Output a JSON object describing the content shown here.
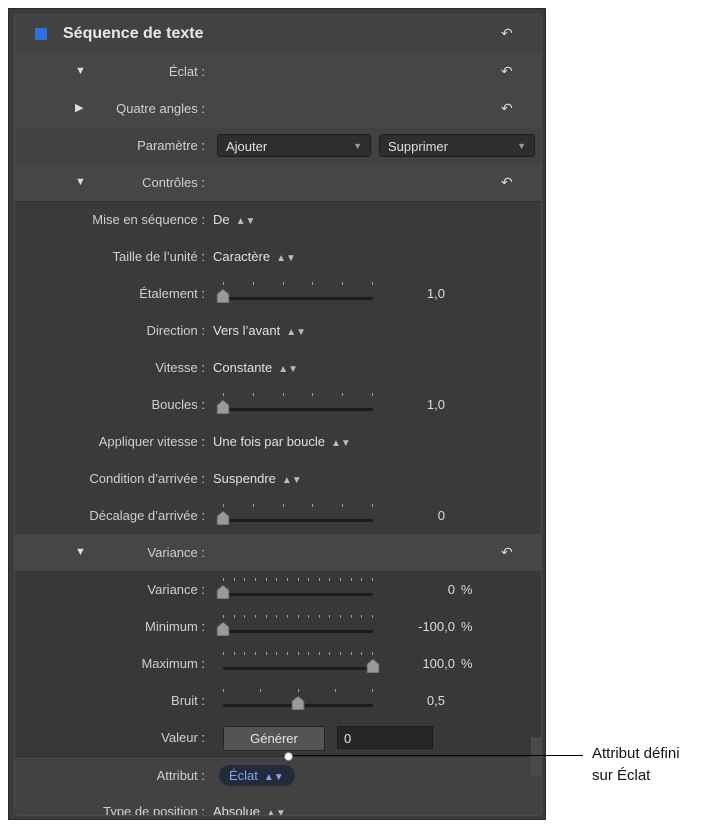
{
  "panel": {
    "title": "Séquence de texte",
    "accent": "#2f6fe0"
  },
  "rows": {
    "eclat": {
      "label": "Éclat :"
    },
    "quatre": {
      "label": "Quatre angles :"
    },
    "parametre": {
      "label": "Paramètre :",
      "add": "Ajouter",
      "remove": "Supprimer"
    },
    "controles": {
      "label": "Contrôles :"
    },
    "mise": {
      "label": "Mise en séquence :",
      "value": "De"
    },
    "taille": {
      "label": "Taille de l’unité :",
      "value": "Caractère"
    },
    "etalement": {
      "label": "Étalement :",
      "value": "1,0",
      "level": 0.0
    },
    "direction": {
      "label": "Direction :",
      "value": "Vers l’avant"
    },
    "vitesse": {
      "label": "Vitesse :",
      "value": "Constante"
    },
    "boucles": {
      "label": "Boucles :",
      "value": "1,0",
      "level": 0.0
    },
    "appliquer": {
      "label": "Appliquer vitesse :",
      "value": "Une fois par boucle"
    },
    "condition": {
      "label": "Condition d’arrivée :",
      "value": "Suspendre"
    },
    "decalage": {
      "label": "Décalage d’arrivée :",
      "value": "0",
      "level": 0.0
    },
    "variance_head": {
      "label": "Variance :"
    },
    "variance": {
      "label": "Variance :",
      "value": "0",
      "unit": "%",
      "level": 0.0
    },
    "minimum": {
      "label": "Minimum :",
      "value": "-100,0",
      "unit": "%",
      "level": 0.0
    },
    "maximum": {
      "label": "Maximum :",
      "value": "100,0",
      "unit": "%",
      "level": 1.0
    },
    "bruit": {
      "label": "Bruit :",
      "value": "0,5",
      "level": 0.5
    },
    "valeur": {
      "label": "Valeur :",
      "button": "Générer",
      "field": "0"
    },
    "attribut": {
      "label": "Attribut :",
      "value": "Éclat"
    },
    "type": {
      "label": "Type de position :",
      "value": "Absolue"
    }
  },
  "callout": {
    "line1": "Attribut défini",
    "line2": "sur Éclat"
  }
}
